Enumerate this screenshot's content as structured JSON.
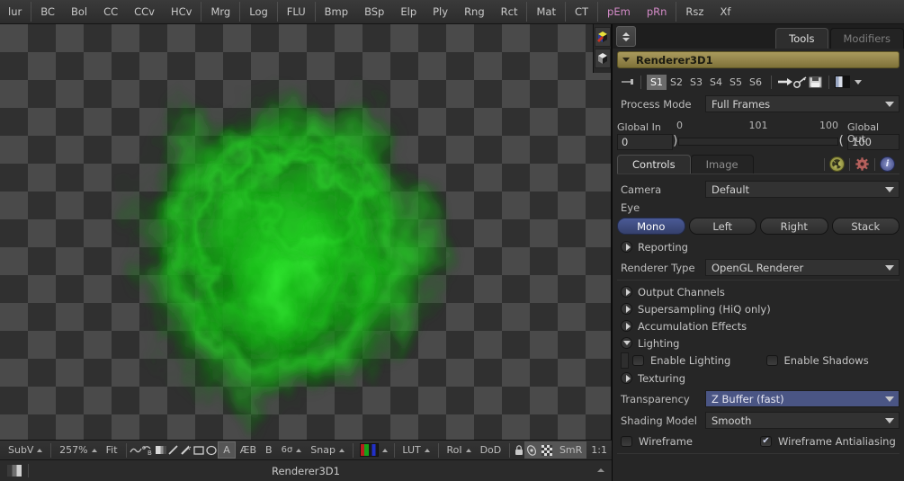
{
  "top_toolbar": {
    "groups": [
      {
        "items": [
          {
            "label": "lur",
            "color": "normal"
          }
        ]
      },
      {
        "items": [
          {
            "label": "BC",
            "color": "normal"
          },
          {
            "label": "Bol",
            "color": "normal"
          },
          {
            "label": "CC",
            "color": "normal"
          },
          {
            "label": "CCv",
            "color": "normal"
          },
          {
            "label": "HCv",
            "color": "normal"
          }
        ]
      },
      {
        "items": [
          {
            "label": "Mrg",
            "color": "normal"
          }
        ]
      },
      {
        "items": [
          {
            "label": "Log",
            "color": "normal"
          }
        ]
      },
      {
        "items": [
          {
            "label": "FLU",
            "color": "normal"
          }
        ]
      },
      {
        "items": [
          {
            "label": "Bmp",
            "color": "normal"
          },
          {
            "label": "BSp",
            "color": "normal"
          },
          {
            "label": "Elp",
            "color": "normal"
          },
          {
            "label": "Ply",
            "color": "normal"
          },
          {
            "label": "Rng",
            "color": "normal"
          },
          {
            "label": "Rct",
            "color": "normal"
          }
        ]
      },
      {
        "items": [
          {
            "label": "Mat",
            "color": "normal"
          }
        ]
      },
      {
        "items": [
          {
            "label": "CT",
            "color": "normal"
          }
        ]
      },
      {
        "items": [
          {
            "label": "pEm",
            "color": "pink"
          },
          {
            "label": "pRn",
            "color": "pink"
          }
        ]
      },
      {
        "items": [
          {
            "label": "Rsz",
            "color": "normal"
          },
          {
            "label": "Xf",
            "color": "normal"
          }
        ]
      }
    ]
  },
  "viewer": {
    "side_icons": [
      "color-cube-icon",
      "grayscale-cube-icon"
    ],
    "toolbar": {
      "subview_label": "SubV",
      "zoom_label": "257%",
      "fit_label": "Fit",
      "icons": [
        "curve-icon",
        "bspline-icon",
        "gradient-icon",
        "line-icon",
        "wand-icon",
        "rectangle-icon",
        "ellipse-icon"
      ],
      "text_a": "A",
      "text_ab": "ÆB",
      "text_b": "B",
      "glasses_label": "6σ",
      "snap_label": "Snap",
      "lut_label": "LUT",
      "roi_label": "RoI",
      "dod_label": "DoD",
      "lock_icon": "lock-icon",
      "orbit_icon": "orbit-icon",
      "checker_icon": "checker-icon",
      "smr_label": "SmR",
      "ratio_label": "1:1"
    },
    "statusbar": {
      "title": "Renderer3D1"
    }
  },
  "right_panel": {
    "tabs": [
      {
        "label": "Tools",
        "active": true
      },
      {
        "label": "Modifiers",
        "active": false
      }
    ],
    "node_name": "Renderer3D1",
    "version_buttons": [
      "S1",
      "S2",
      "S3",
      "S4",
      "S5",
      "S6"
    ],
    "active_version": "S1",
    "icon_row": [
      "pin-icon",
      "arrow-right-icon",
      "key-icon",
      "save-icon",
      "color-split-icon",
      "dropdown-caret-icon"
    ],
    "process_mode": {
      "label": "Process Mode",
      "value": "Full Frames"
    },
    "global_range": {
      "in_label": "Global In",
      "in_value": "0",
      "out_label": "Global Out",
      "out_value": "100",
      "tick_left": "0",
      "tick_mid": "101",
      "tick_right": "100"
    },
    "sub_tabs": [
      {
        "label": "Controls",
        "active": true
      },
      {
        "label": "Image",
        "active": false
      }
    ],
    "sub_tab_icons": [
      "radiation-icon",
      "gear-icon",
      "info-icon"
    ],
    "camera": {
      "label": "Camera",
      "value": "Default"
    },
    "eye": {
      "label": "Eye",
      "options": [
        "Mono",
        "Left",
        "Right",
        "Stack"
      ],
      "selected": "Mono"
    },
    "reporting": {
      "label": "Reporting",
      "expanded": false
    },
    "renderer_type": {
      "label": "Renderer Type",
      "value": "OpenGL Renderer"
    },
    "sections": [
      {
        "label": "Output Channels",
        "expanded": false
      },
      {
        "label": "Supersampling (HiQ only)",
        "expanded": false
      },
      {
        "label": "Accumulation Effects",
        "expanded": false
      },
      {
        "label": "Lighting",
        "expanded": true
      }
    ],
    "lighting_checks": [
      {
        "label": "Enable Lighting",
        "checked": false
      },
      {
        "label": "Enable Shadows",
        "checked": false
      }
    ],
    "texturing": {
      "label": "Texturing",
      "expanded": false
    },
    "transparency": {
      "label": "Transparency",
      "value": "Z Buffer (fast)",
      "highlighted": true
    },
    "shading_model": {
      "label": "Shading Model",
      "value": "Smooth"
    },
    "wireframe_checks": [
      {
        "label": "Wireframe",
        "checked": false
      },
      {
        "label": "Wireframe Antialiasing",
        "checked": true
      }
    ]
  },
  "colors": {
    "accent_gold": "#998a4f",
    "accent_blue": "#4a5584",
    "pink_text": "#d48bc8",
    "blob_green": "#24c024",
    "panel_bg": "#262626"
  }
}
